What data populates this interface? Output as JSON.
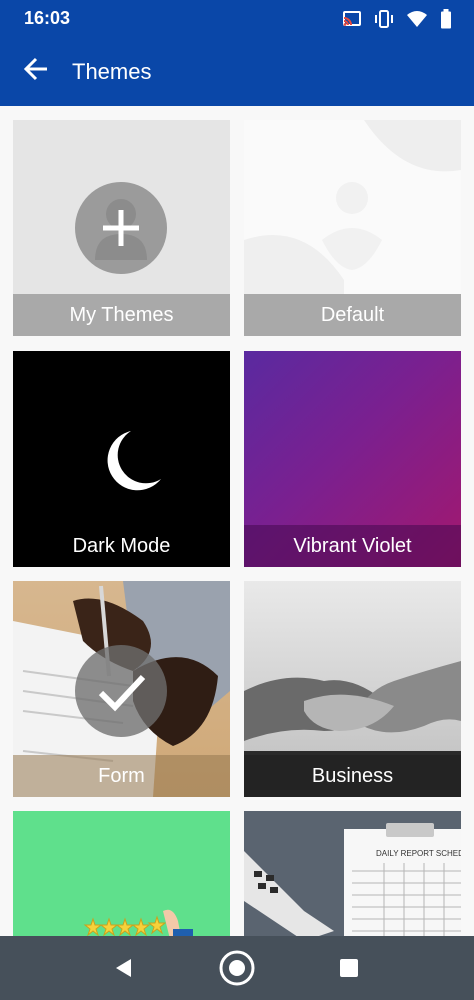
{
  "status_bar": {
    "time": "16:03",
    "icons": [
      "cast-icon",
      "vibrate-icon",
      "wifi-icon",
      "battery-icon"
    ]
  },
  "app_bar": {
    "title": "Themes",
    "back_icon": "arrow-back-icon"
  },
  "themes": [
    {
      "label": "My Themes",
      "icon": "add-icon",
      "selected": false
    },
    {
      "label": "Default",
      "selected": false
    },
    {
      "label": "Dark Mode",
      "icon": "moon-icon",
      "selected": false
    },
    {
      "label": "Vibrant Violet",
      "selected": false
    },
    {
      "label": "Form",
      "icon": "checkmark-icon",
      "selected": true
    },
    {
      "label": "Business",
      "selected": false
    },
    {
      "label": "",
      "selected": false
    },
    {
      "label": "",
      "selected": false
    }
  ],
  "report_card_text": "DAILY REPORT SCHED",
  "colors": {
    "primary": "#0a47a8",
    "nav_bar": "#46505a",
    "violet_start": "#5a2aa0",
    "violet_end": "#a3186e",
    "green": "#5fe08c"
  },
  "nav_bar": {
    "icons": [
      "back-triangle-icon",
      "home-circle-icon",
      "recents-square-icon"
    ]
  }
}
